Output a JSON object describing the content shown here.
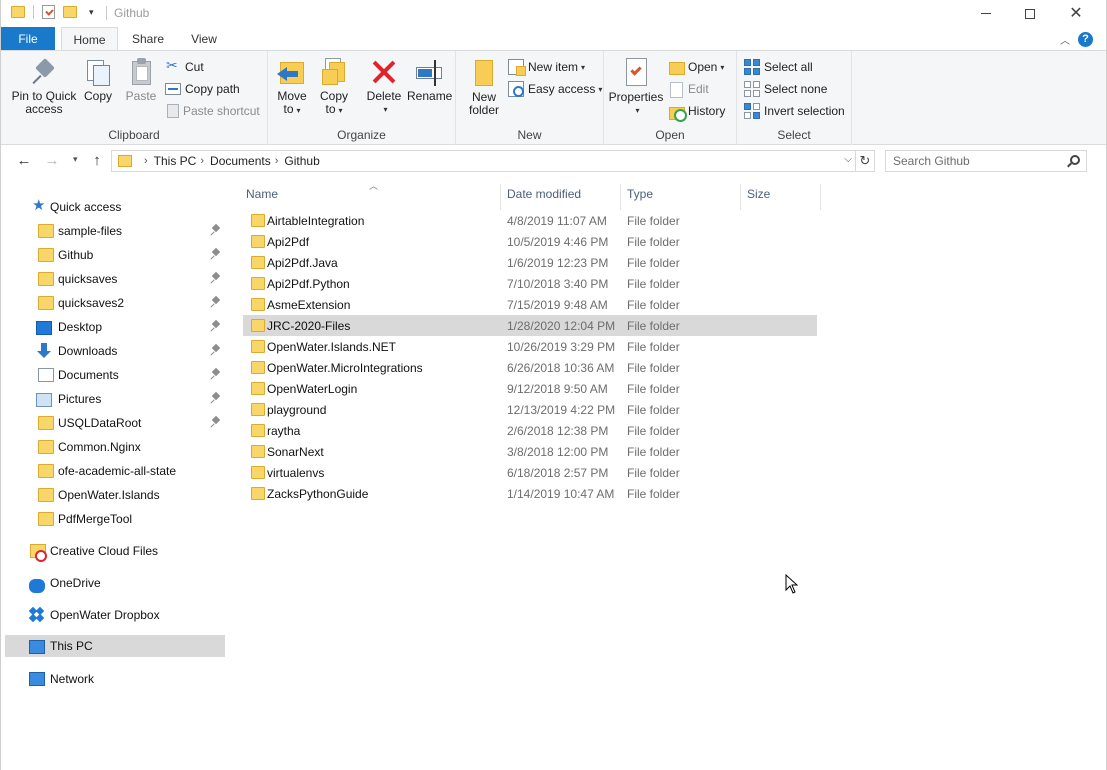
{
  "window": {
    "title": "Github"
  },
  "ribbon_tabs": {
    "file": "File",
    "home": "Home",
    "share": "Share",
    "view": "View",
    "help": "?"
  },
  "ribbon": {
    "clipboard": {
      "label": "Clipboard",
      "pin_line1": "Pin to Quick",
      "pin_line2": "access",
      "copy": "Copy",
      "paste": "Paste",
      "cut": "Cut",
      "copy_path": "Copy path",
      "paste_shortcut": "Paste shortcut"
    },
    "organize": {
      "label": "Organize",
      "move_to_line1": "Move",
      "move_to_line2": "to",
      "copy_to_line1": "Copy",
      "copy_to_line2": "to",
      "delete": "Delete",
      "rename": "Rename"
    },
    "new": {
      "label": "New",
      "new_folder_line1": "New",
      "new_folder_line2": "folder",
      "new_item": "New item",
      "easy_access": "Easy access"
    },
    "open": {
      "label": "Open",
      "properties": "Properties",
      "open": "Open",
      "edit": "Edit",
      "history": "History"
    },
    "select": {
      "label": "Select",
      "select_all": "Select all",
      "select_none": "Select none",
      "invert_selection": "Invert selection"
    }
  },
  "address": {
    "breadcrumb": [
      "This PC",
      "Documents",
      "Github"
    ],
    "search_placeholder": "Search Github"
  },
  "sidebar": {
    "quick_access": "Quick access",
    "pinned": [
      {
        "label": "sample-files",
        "icon": "folder-icon"
      },
      {
        "label": "Github",
        "icon": "folder-icon"
      },
      {
        "label": "quicksaves",
        "icon": "folder-icon"
      },
      {
        "label": "quicksaves2",
        "icon": "folder-icon"
      },
      {
        "label": "Desktop",
        "icon": "desktop-icon"
      },
      {
        "label": "Downloads",
        "icon": "downloads-icon"
      },
      {
        "label": "Documents",
        "icon": "documents-icon"
      },
      {
        "label": "Pictures",
        "icon": "pictures-icon"
      },
      {
        "label": "USQLDataRoot",
        "icon": "folder-icon"
      }
    ],
    "recent": [
      {
        "label": "Common.Nginx"
      },
      {
        "label": "ofe-academic-all-state"
      },
      {
        "label": "OpenWater.Islands"
      },
      {
        "label": "PdfMergeTool"
      }
    ],
    "creative_cloud": "Creative Cloud Files",
    "onedrive": "OneDrive",
    "dropbox": "OpenWater Dropbox",
    "this_pc": "This PC",
    "network": "Network"
  },
  "file_list": {
    "columns": {
      "name": "Name",
      "date": "Date modified",
      "type": "Type",
      "size": "Size"
    },
    "selected_index": 5,
    "rows": [
      {
        "name": "AirtableIntegration",
        "date": "4/8/2019 11:07 AM",
        "type": "File folder"
      },
      {
        "name": "Api2Pdf",
        "date": "10/5/2019 4:46 PM",
        "type": "File folder"
      },
      {
        "name": "Api2Pdf.Java",
        "date": "1/6/2019 12:23 PM",
        "type": "File folder"
      },
      {
        "name": "Api2Pdf.Python",
        "date": "7/10/2018 3:40 PM",
        "type": "File folder"
      },
      {
        "name": "AsmeExtension",
        "date": "7/15/2019 9:48 AM",
        "type": "File folder"
      },
      {
        "name": "JRC-2020-Files",
        "date": "1/28/2020 12:04 PM",
        "type": "File folder"
      },
      {
        "name": "OpenWater.Islands.NET",
        "date": "10/26/2019 3:29 PM",
        "type": "File folder"
      },
      {
        "name": "OpenWater.MicroIntegrations",
        "date": "6/26/2018 10:36 AM",
        "type": "File folder"
      },
      {
        "name": "OpenWaterLogin",
        "date": "9/12/2018 9:50 AM",
        "type": "File folder"
      },
      {
        "name": "playground",
        "date": "12/13/2019 4:22 PM",
        "type": "File folder"
      },
      {
        "name": "raytha",
        "date": "2/6/2018 12:38 PM",
        "type": "File folder"
      },
      {
        "name": "SonarNext",
        "date": "3/8/2018 12:00 PM",
        "type": "File folder"
      },
      {
        "name": "virtualenvs",
        "date": "6/18/2018 2:57 PM",
        "type": "File folder"
      },
      {
        "name": "ZacksPythonGuide",
        "date": "1/14/2019 10:47 AM",
        "type": "File folder"
      }
    ]
  },
  "colors": {
    "accent": "#1979ca",
    "folder": "#f9d66a",
    "selection": "#d9d9d9",
    "header_text": "#4c607a"
  }
}
